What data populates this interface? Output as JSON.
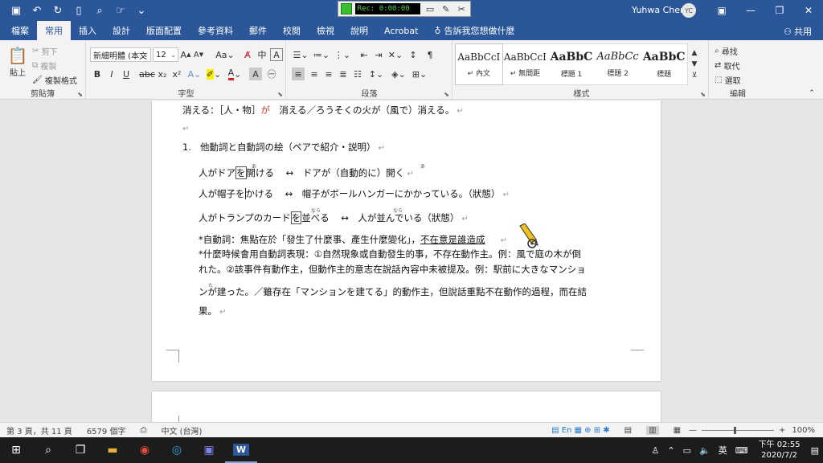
{
  "recorder": {
    "timer": "Rec: 0:00:00"
  },
  "titlebar": {
    "user": "Yuhwa Chen",
    "avatar": "YC"
  },
  "tabs": [
    "檔案",
    "常用",
    "插入",
    "設計",
    "版面配置",
    "參考資料",
    "郵件",
    "校閱",
    "檢視",
    "說明",
    "Acrobat"
  ],
  "tell_me": "告訴我您想做什麼",
  "share": "共用",
  "ribbon": {
    "clipboard": {
      "label": "剪貼簿",
      "paste": "貼上",
      "cut": "剪下",
      "copy": "複製",
      "format_painter": "複製格式"
    },
    "font": {
      "label": "字型",
      "font_name": "新細明體 (本文",
      "font_size": "12"
    },
    "paragraph": {
      "label": "段落"
    },
    "styles": {
      "label": "樣式",
      "items": [
        {
          "preview": "AaBbCcI",
          "name": "↵ 內文"
        },
        {
          "preview": "AaBbCcI",
          "name": "↵ 無間距"
        },
        {
          "preview": "AaBbC",
          "name": "標題 1"
        },
        {
          "preview": "AaBbCc",
          "name": "標題 2"
        },
        {
          "preview": "AaBbC",
          "name": "標題"
        }
      ]
    },
    "editing": {
      "label": "編輯",
      "find": "尋找",
      "replace": "取代",
      "select": "選取"
    }
  },
  "document": {
    "line1_pre": "消える：［人・物］",
    "line1_red": "が",
    "line1_post": "　消える／ろうそくの火が（風で）消える。",
    "item_number": "1.",
    "item_text": "他動詞と自動詞の絵（ペアで紹介・説明）",
    "pair1_a": "人がドア",
    "pair1_o": "を",
    "pair1_b": "開ける",
    "pair1_c": "↔　ドアが（自動的に）開く",
    "pair1_ruby": "あ",
    "pair2_a": "人が帽子",
    "pair2_o": "を",
    "pair2_b": "かける",
    "pair2_c": "↔　帽子がボールハンガーにかかっている。（狀態）",
    "pair3_a": "人がトランプのカード",
    "pair3_o": "を",
    "pair3_b": "並べる",
    "pair3_c": "↔　人が並んでいる（狀態）",
    "pair3_ruby": "なら",
    "note1_pre": "*自動詞：焦點在於「發生了什麼事、產生什麼變化」，",
    "note1_u": "不在意是誰造成",
    "note2": "*什麼時候會用自動詞表現：①自然現象或自動發生的事，不存在動作主。例：風で庭の木が倒",
    "note3": "れた。②該事件有動作主，但動作主的意志在說話內容中未被提及。例：駅前に大きなマンショ",
    "note4": "ンが建った。／雖存在「マンションを建てる」的動作主，但說話重點不在動作的過程，而在結",
    "note4_ruby": "た",
    "note5": "果。"
  },
  "statusbar": {
    "page": "第 3 頁，共 11 頁",
    "words": "6579 個字",
    "language": "中文 (台灣)",
    "zoom": "100%"
  },
  "taskbar": {
    "ime": "英",
    "time": "下午 02:55",
    "date": "2020/7/2"
  }
}
